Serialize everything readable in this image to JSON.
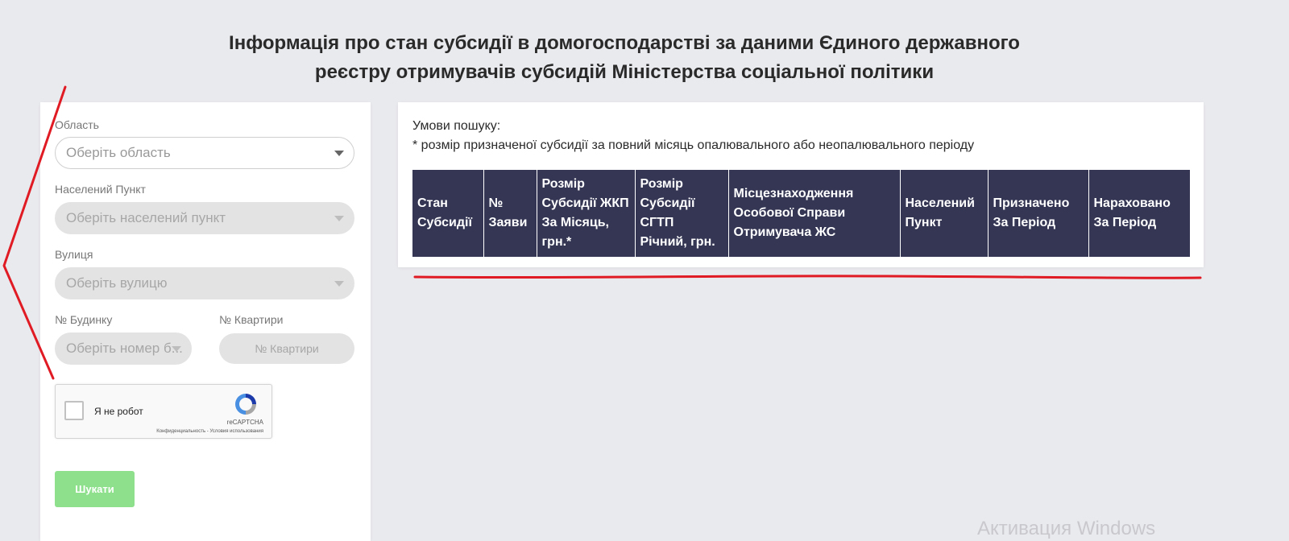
{
  "page": {
    "title_line1": "Інформація про стан субсидії в домогосподарстві за даними Єдиного державного",
    "title_line2": "реєстру отримувачів субсидій Міністерства соціальної політики"
  },
  "search_form": {
    "region": {
      "label": "Область",
      "placeholder": "Оберіть область"
    },
    "settlement": {
      "label": "Населений Пункт",
      "placeholder": "Оберіть населений пункт"
    },
    "street": {
      "label": "Вулиця",
      "placeholder": "Оберіть вулицю"
    },
    "house": {
      "label": "№ Будинку",
      "placeholder": "Оберіть номер б..."
    },
    "apartment": {
      "label": "№ Квартири",
      "placeholder": "№ Квартири"
    },
    "recaptcha": {
      "label": "Я не робот",
      "brand": "reCAPTCHA",
      "terms": "Конфиденциальность - Условия использования"
    },
    "submit_label": "Шукати"
  },
  "results": {
    "conditions_title": "Умови пошуку:",
    "conditions_note": "* розмір призначеної субсидії за повний місяць опалювального або неопалювального періоду",
    "columns": [
      "Стан Субсидії",
      "№ Заяви",
      "Розмір Субсидії ЖКП За Місяць, грн.*",
      "Розмір Субсидії СГТП Річний, грн.",
      "Місцезнаходження Особової Справи Отримувача ЖС",
      "Населений Пункт",
      "Призначено За Період",
      "Нараховано За Період"
    ]
  },
  "watermark": "Активация Windows",
  "colors": {
    "page_background": "#e9eaee",
    "table_header": "#343654",
    "button_disabled_green": "#8ee08c",
    "annotation_red": "#e01b24"
  },
  "icons": {
    "select_caret": "chevron-down-icon",
    "recaptcha_logo": "recaptcha-icon"
  }
}
